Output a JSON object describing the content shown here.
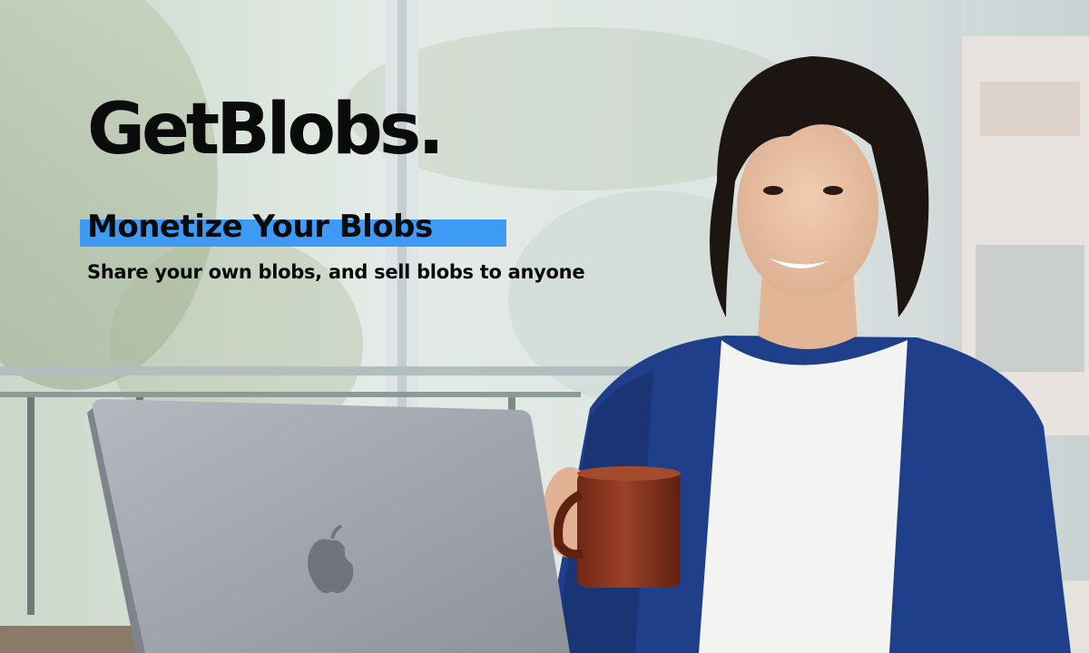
{
  "hero": {
    "brand": "GetBlobs.",
    "tagline": "Monetize Your Blobs",
    "subline": "Share your own blobs, and sell blobs to anyone"
  },
  "photo": {
    "subject": "smiling man with coffee mug at laptop",
    "colors": {
      "highlight": "#3d9bf5",
      "cardigan": "#1f3f8a",
      "tshirt": "#f3f3f1",
      "mug": "#8a3520",
      "laptop": "#9ea3ab",
      "text": "#0b0b0b"
    }
  }
}
